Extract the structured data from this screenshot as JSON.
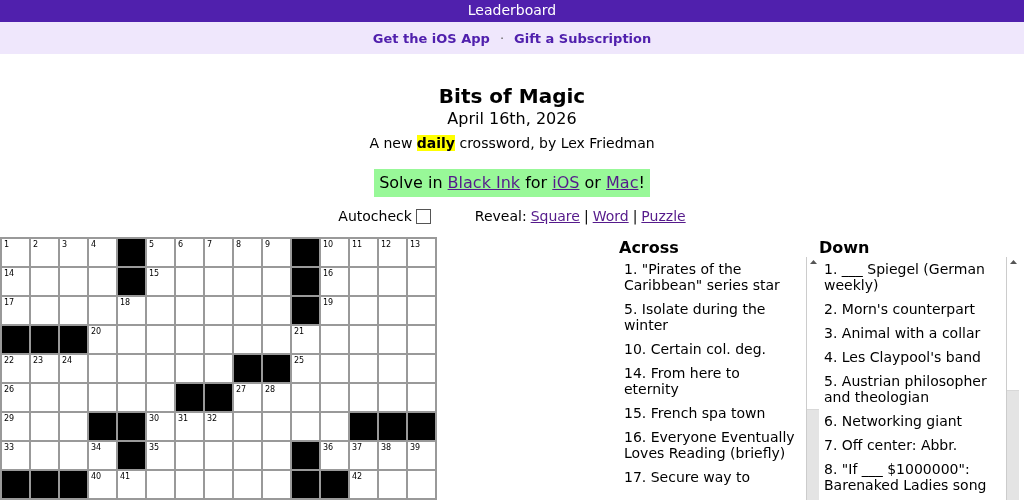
{
  "header": {
    "title": "Leaderboard"
  },
  "promo_links": [
    {
      "label": "Get the iOS App"
    },
    {
      "label": "Gift a Subscription"
    }
  ],
  "promo_separator": "·",
  "puzzle": {
    "title": "Bits of Magic",
    "date": "April 16th, 2026",
    "byline": "A new **daily** crossword, by Lex Friedman"
  },
  "banner": {
    "parts": [
      {
        "kind": "text",
        "text": "Solve in "
      },
      {
        "kind": "link",
        "text": "Black Ink"
      },
      {
        "kind": "text",
        "text": " for "
      },
      {
        "kind": "link",
        "text": "iOS"
      },
      {
        "kind": "text",
        "text": " or "
      },
      {
        "kind": "link",
        "text": "Mac"
      },
      {
        "kind": "text",
        "text": "!"
      }
    ]
  },
  "autocheck": {
    "label": "Autocheck",
    "checked": false
  },
  "reveal": {
    "label": "Reveal:",
    "separator": "|",
    "options": [
      "Square",
      "Word",
      "Puzzle"
    ]
  },
  "grid": {
    "rows": [
      [
        {
          "number": "1",
          "black": false
        },
        {
          "number": "2",
          "black": false
        },
        {
          "number": "3",
          "black": false
        },
        {
          "number": "4",
          "black": false
        },
        {
          "black": true
        },
        {
          "number": "5",
          "black": false
        },
        {
          "number": "6",
          "black": false
        },
        {
          "number": "7",
          "black": false
        },
        {
          "number": "8",
          "black": false
        },
        {
          "number": "9",
          "black": false
        },
        {
          "black": true
        },
        {
          "number": "10",
          "black": false
        },
        {
          "number": "11",
          "black": false
        },
        {
          "number": "12",
          "black": false
        },
        {
          "number": "13",
          "black": false
        }
      ],
      [
        {
          "number": "14",
          "black": false
        },
        {
          "black": false
        },
        {
          "black": false
        },
        {
          "black": false
        },
        {
          "black": true
        },
        {
          "number": "15",
          "black": false
        },
        {
          "black": false
        },
        {
          "black": false
        },
        {
          "black": false
        },
        {
          "black": false
        },
        {
          "black": true
        },
        {
          "number": "16",
          "black": false
        },
        {
          "black": false
        },
        {
          "black": false
        },
        {
          "black": false
        }
      ],
      [
        {
          "number": "17",
          "black": false
        },
        {
          "black": false
        },
        {
          "black": false
        },
        {
          "black": false
        },
        {
          "number": "18",
          "black": false
        },
        {
          "black": false
        },
        {
          "black": false
        },
        {
          "black": false
        },
        {
          "black": false
        },
        {
          "black": false
        },
        {
          "black": true
        },
        {
          "number": "19",
          "black": false
        },
        {
          "black": false
        },
        {
          "black": false
        },
        {
          "black": false
        }
      ],
      [
        {
          "black": true
        },
        {
          "black": true
        },
        {
          "black": true
        },
        {
          "number": "20",
          "black": false
        },
        {
          "black": false
        },
        {
          "black": false
        },
        {
          "black": false
        },
        {
          "black": false
        },
        {
          "black": false
        },
        {
          "black": false
        },
        {
          "number": "21",
          "black": false
        },
        {
          "black": false
        },
        {
          "black": false
        },
        {
          "black": false
        },
        {
          "black": false
        }
      ],
      [
        {
          "number": "22",
          "black": false
        },
        {
          "number": "23",
          "black": false
        },
        {
          "number": "24",
          "black": false
        },
        {
          "black": false
        },
        {
          "black": false
        },
        {
          "black": false
        },
        {
          "black": false
        },
        {
          "black": false
        },
        {
          "black": true
        },
        {
          "black": true
        },
        {
          "number": "25",
          "black": false
        },
        {
          "black": false
        },
        {
          "black": false
        },
        {
          "black": false
        },
        {
          "black": false
        }
      ],
      [
        {
          "number": "26",
          "black": false
        },
        {
          "black": false
        },
        {
          "black": false
        },
        {
          "black": false
        },
        {
          "black": false
        },
        {
          "black": false
        },
        {
          "black": true
        },
        {
          "black": true
        },
        {
          "number": "27",
          "black": false
        },
        {
          "number": "28",
          "black": false
        },
        {
          "black": false
        },
        {
          "black": false
        },
        {
          "black": false
        },
        {
          "black": false
        },
        {
          "black": false
        }
      ],
      [
        {
          "number": "29",
          "black": false
        },
        {
          "black": false
        },
        {
          "black": false
        },
        {
          "black": true
        },
        {
          "black": true
        },
        {
          "number": "30",
          "black": false
        },
        {
          "number": "31",
          "black": false
        },
        {
          "number": "32",
          "black": false
        },
        {
          "black": false
        },
        {
          "black": false
        },
        {
          "black": false
        },
        {
          "black": false
        },
        {
          "black": true
        },
        {
          "black": true
        },
        {
          "black": true
        }
      ],
      [
        {
          "number": "33",
          "black": false
        },
        {
          "black": false
        },
        {
          "black": false
        },
        {
          "number": "34",
          "black": false
        },
        {
          "black": true
        },
        {
          "number": "35",
          "black": false
        },
        {
          "black": false
        },
        {
          "black": false
        },
        {
          "black": false
        },
        {
          "black": false
        },
        {
          "black": true
        },
        {
          "number": "36",
          "black": false
        },
        {
          "number": "37",
          "black": false
        },
        {
          "number": "38",
          "black": false
        },
        {
          "number": "39",
          "black": false
        }
      ],
      [
        {
          "black": true
        },
        {
          "black": true
        },
        {
          "black": true
        },
        {
          "number": "40",
          "black": false
        },
        {
          "number": "41",
          "black": false
        },
        {
          "black": false
        },
        {
          "black": false
        },
        {
          "black": false
        },
        {
          "black": false
        },
        {
          "black": false
        },
        {
          "black": true
        },
        {
          "black": true
        },
        {
          "number": "42",
          "black": false
        },
        {
          "black": false
        },
        {
          "black": false
        }
      ]
    ]
  },
  "clue_lists": [
    {
      "title": "Across",
      "clues": [
        "1. \"Pirates of the Caribbean\" series star",
        "5. Isolate during the winter",
        "10. Certain col. deg.",
        "14. From here to eternity",
        "15. French spa town",
        "16. Everyone Eventually Loves Reading (briefly)",
        "17. Secure way to"
      ]
    },
    {
      "title": "Down",
      "clues": [
        "1. ___ Spiegel (German weekly)",
        "2. Morn's counterpart",
        "3. Animal with a collar",
        "4. Les Claypool's band",
        "5. Austrian philosopher and theologian",
        "6. Networking giant",
        "7. Off center: Abbr.",
        "8. \"If ___ $1000000\": Barenaked Ladies song"
      ]
    }
  ]
}
